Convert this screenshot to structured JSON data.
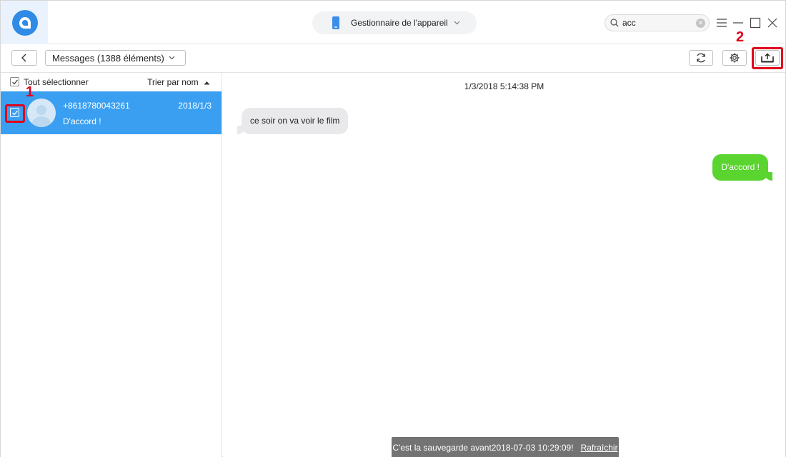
{
  "header": {
    "logo_icon": "app-logo-icon",
    "device_label": "Gestionnaire de l'appareil",
    "search": {
      "value": "acc",
      "placeholder": ""
    }
  },
  "toolbar": {
    "category_label": "Messages (1388 éléments)"
  },
  "list": {
    "select_all_label": "Tout sélectionner",
    "sort_label": "Trier par nom",
    "items": [
      {
        "name": "+8618780043261",
        "date": "2018/1/3",
        "preview": "D'accord !",
        "selected": true
      }
    ]
  },
  "conversation": {
    "timestamp": "1/3/2018 5:14:38 PM",
    "messages": [
      {
        "direction": "in",
        "text": "ce soir on va voir le film"
      },
      {
        "direction": "out",
        "text": "D'accord !"
      }
    ]
  },
  "annotations": {
    "marker_1": "1",
    "marker_2": "2"
  },
  "status": {
    "message": "C'est la sauvegarde avant2018-07-03 10:29:09!",
    "link": "Rafraîchir"
  },
  "colors": {
    "accent": "#3a9ff1",
    "outgoing_bubble": "#5ad42f",
    "incoming_bubble": "#e9e9eb",
    "highlight": "#e0001b"
  }
}
